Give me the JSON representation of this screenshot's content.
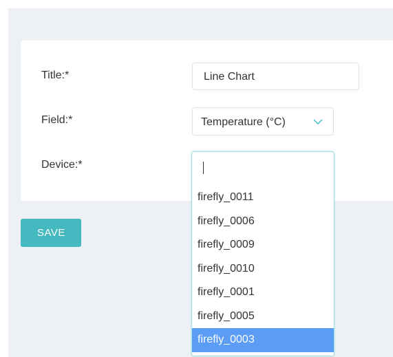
{
  "form": {
    "title_label": "Title:*",
    "title_value": "Line Chart",
    "field_label": "Field:*",
    "field_value": "Temperature (°C)",
    "device_label": "Device:*",
    "device_value": ""
  },
  "device_options": [
    "firefly_0011",
    "firefly_0006",
    "firefly_0009",
    "firefly_0010",
    "firefly_0001",
    "firefly_0005",
    "firefly_0003"
  ],
  "highlighted_option": "firefly_0003",
  "save_label": "SAVE",
  "icons": {
    "field_select": "chevron-down-icon"
  },
  "colors": {
    "accent": "#45b9c0",
    "highlight": "#5b9cf5",
    "background": "#edf1f5"
  }
}
